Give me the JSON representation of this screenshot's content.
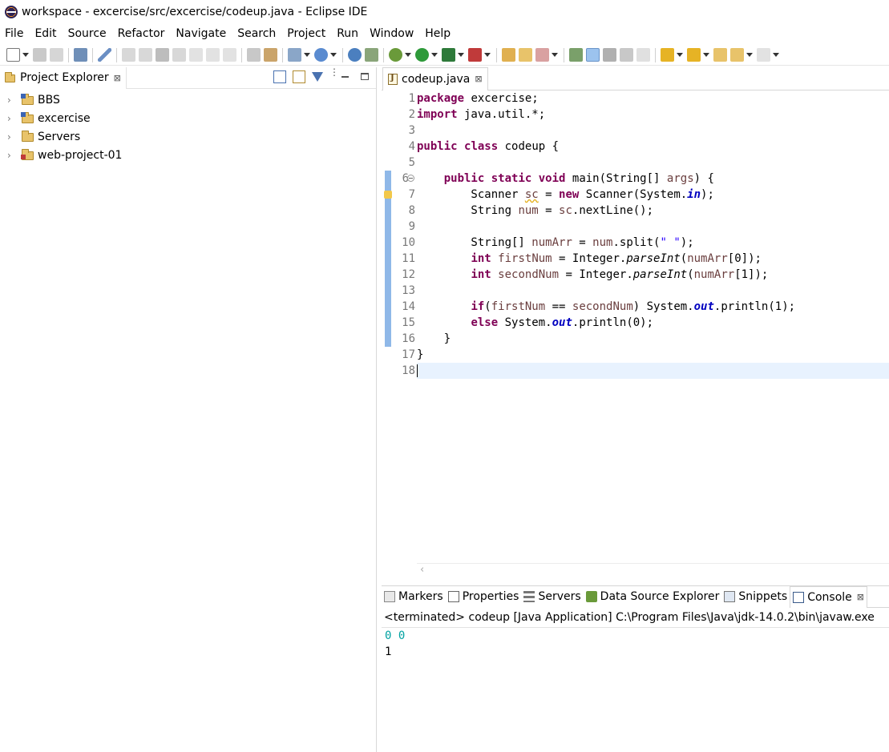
{
  "window": {
    "title": "workspace - excercise/src/excercise/codeup.java - Eclipse IDE"
  },
  "menu": [
    "File",
    "Edit",
    "Source",
    "Refactor",
    "Navigate",
    "Search",
    "Project",
    "Run",
    "Window",
    "Help"
  ],
  "project_explorer": {
    "tab_label": "Project Explorer",
    "items": [
      {
        "label": "BBS",
        "icon": "java-project-icon"
      },
      {
        "label": "excercise",
        "icon": "java-project-icon"
      },
      {
        "label": "Servers",
        "icon": "folder-icon"
      },
      {
        "label": "web-project-01",
        "icon": "web-project-icon"
      }
    ]
  },
  "editor": {
    "tab_label": "codeup.java",
    "line_numbers": [
      "1",
      "2",
      "3",
      "4",
      "5",
      "6",
      "7",
      "8",
      "9",
      "10",
      "11",
      "12",
      "13",
      "14",
      "15",
      "16",
      "17",
      "18"
    ]
  },
  "bottom_tabs": [
    {
      "label": "Markers",
      "icon": "markers-icon"
    },
    {
      "label": "Properties",
      "icon": "properties-icon"
    },
    {
      "label": "Servers",
      "icon": "servers-icon"
    },
    {
      "label": "Data Source Explorer",
      "icon": "data-source-icon"
    },
    {
      "label": "Snippets",
      "icon": "snippets-icon"
    },
    {
      "label": "Console",
      "icon": "console-icon"
    }
  ],
  "console": {
    "description": "<terminated> codeup [Java Application] C:\\Program Files\\Java\\jdk-14.0.2\\bin\\javaw.exe",
    "input_line": "0 0",
    "output_line": "1"
  },
  "colors": {
    "keyword": "#7f0055",
    "string": "#2a00ff",
    "field": "#0000c0",
    "local_variable": "#6a3e3e",
    "console_input": "#00a2a2",
    "current_line": "#e8f2fe"
  }
}
